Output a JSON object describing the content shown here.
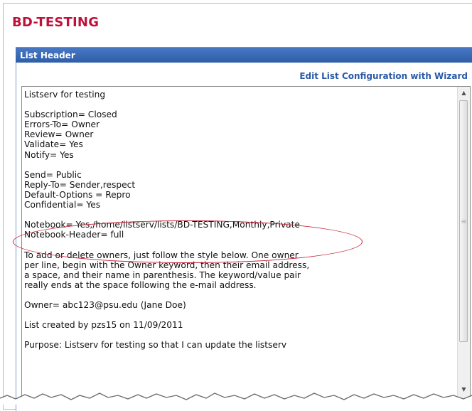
{
  "page": {
    "title": "BD-TESTING"
  },
  "panel": {
    "header": "List Header",
    "wizard_link": "Edit List Configuration with Wizard"
  },
  "list_header": {
    "lines": [
      "Listserv for testing",
      "",
      "Subscription= Closed",
      "Errors-To= Owner",
      "Review= Owner",
      "Validate= Yes",
      "Notify= Yes",
      "",
      "Send= Public",
      "Reply-To= Sender,respect",
      "Default-Options = Repro",
      "Confidential= Yes",
      "",
      "Notebook= Yes,/home/listserv/lists/BD-TESTING,Monthly,Private",
      "Notebook-Header= full",
      "",
      "To add or delete owners, just follow the style below. One owner",
      "per line, begin with the Owner keyword, then their email address,",
      "a space, and their name in parenthesis. The keyword/value pair",
      "really ends at the space following the e-mail address.",
      "",
      "Owner= abc123@psu.edu (Jane Doe)",
      "",
      "List created by pzs15 on 11/09/2011",
      "",
      "Purpose: Listserv for testing so that I can update the listserv"
    ]
  },
  "annotation": {
    "color": "#c4243a"
  },
  "colors": {
    "title": "#c0113a",
    "header_bg": "#2f5ea8",
    "link": "#2859a8"
  }
}
